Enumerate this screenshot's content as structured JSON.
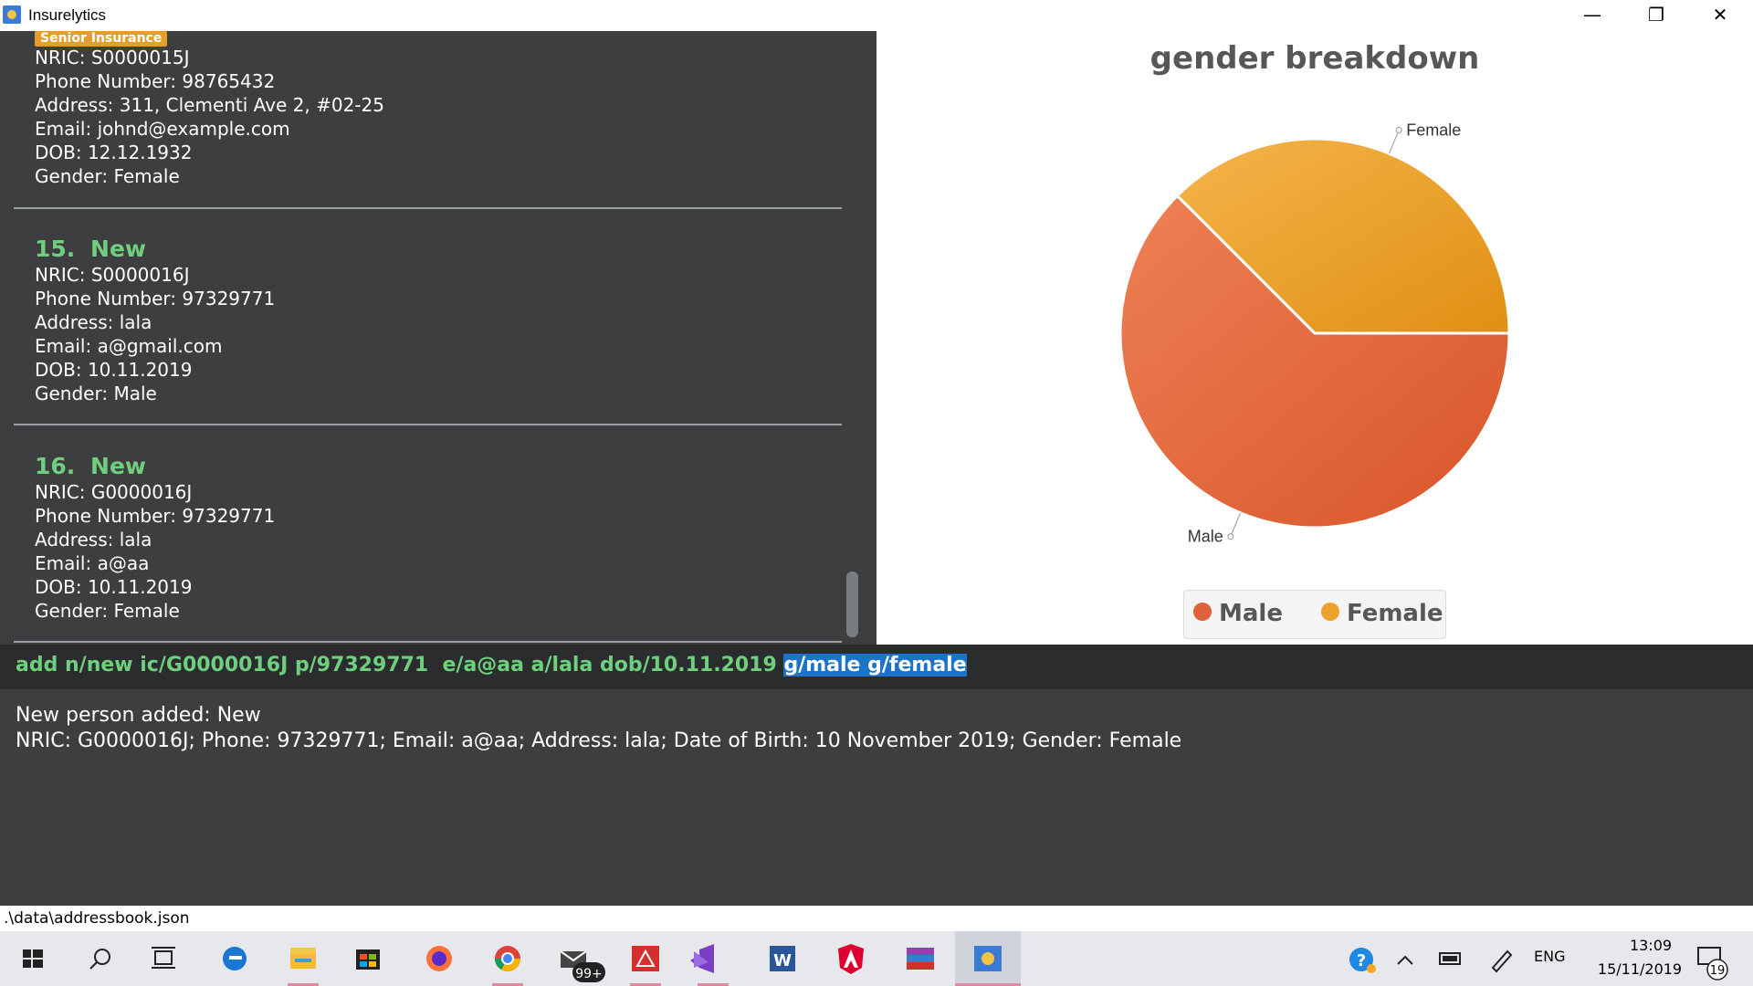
{
  "window": {
    "title": "Insurelytics",
    "controls": {
      "minimize": "—",
      "maximize": "❐",
      "close": "✕"
    }
  },
  "person_list": [
    {
      "tag": "Senior Insurance",
      "fields": [
        "NRIC: S0000015J",
        "Phone Number: 98765432",
        "Address: 311, Clementi Ave 2, #02-25",
        "Email: johnd@example.com",
        "DOB: 12.12.1932",
        "Gender: Female"
      ]
    },
    {
      "index": "15.",
      "name": "New",
      "fields": [
        "NRIC: S0000016J",
        "Phone Number: 97329771",
        "Address: lala",
        "Email: a@gmail.com",
        "DOB: 10.11.2019",
        "Gender: Male"
      ]
    },
    {
      "index": "16.",
      "name": "New",
      "fields": [
        "NRIC: G0000016J",
        "Phone Number: 97329771",
        "Address: lala",
        "Email: a@aa",
        "DOB: 10.11.2019",
        "Gender: Female"
      ]
    }
  ],
  "chart_data": {
    "type": "pie",
    "title": "gender breakdown",
    "categories": [
      "Male",
      "Female"
    ],
    "values": [
      10,
      6
    ],
    "colors": [
      "#e0623a",
      "#eda22b"
    ],
    "legend": "bottom"
  },
  "command": {
    "text": "add n/new ic/G0000016J p/97329771  e/a@aa a/lala dob/10.11.2019 ",
    "selected": "g/male g/female"
  },
  "result": {
    "line1": "New person added: New",
    "line2": "NRIC: G0000016J; Phone: 97329771; Email: a@aa; Address: lala; Date of Birth: 10 November 2019; Gender: Female"
  },
  "status_bar": {
    "path": ".\\data\\addressbook.json"
  },
  "taskbar": {
    "apps": [
      "windows-start-icon",
      "search-icon",
      "task-view-icon",
      "edge-icon",
      "file-explorer-icon",
      "store-icon",
      "firefox-icon",
      "chrome-icon",
      "mail-icon",
      "acrobat-icon",
      "visual-studio-icon",
      "word-icon",
      "angular-icon",
      "winrar-icon",
      "insurelytics-icon"
    ],
    "mail_badge": "99+",
    "language": "ENG",
    "time": "13:09",
    "date": "15/11/2019",
    "notification_count": "19"
  }
}
